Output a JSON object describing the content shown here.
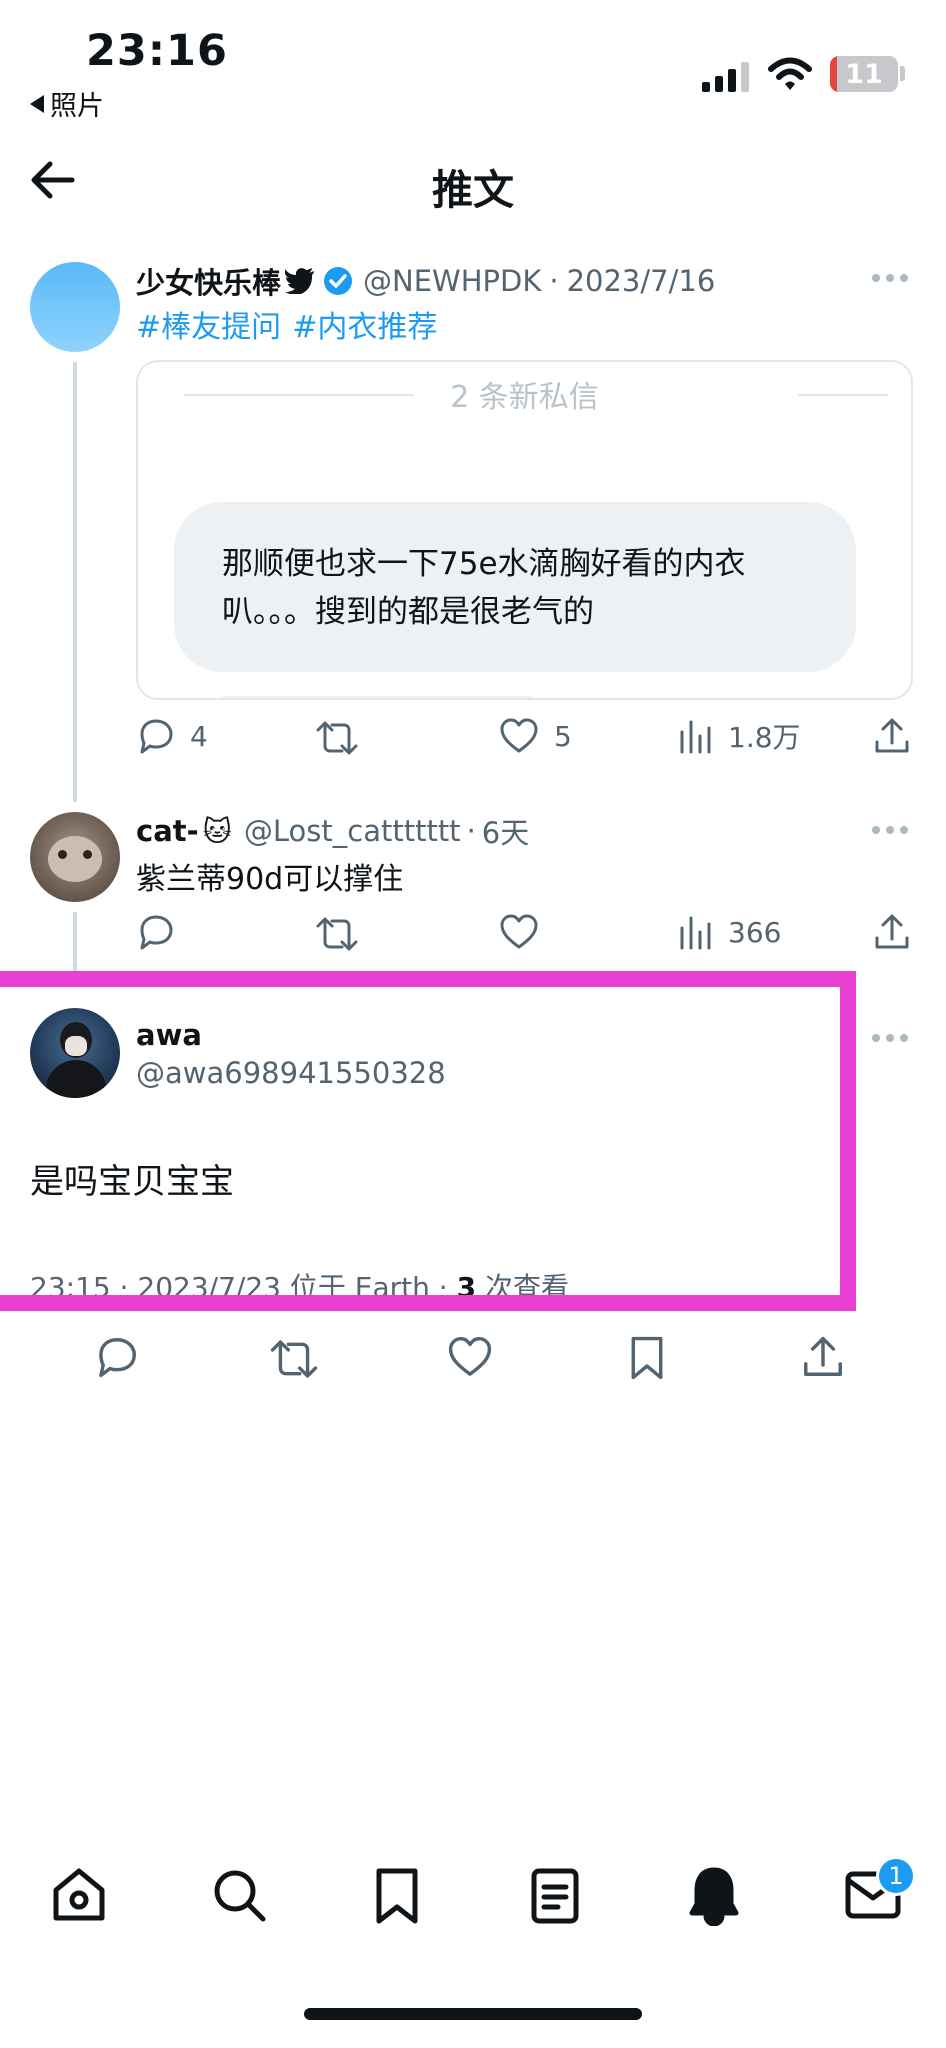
{
  "status_bar": {
    "time": "23:16",
    "back_app": "照片",
    "battery_level": "11"
  },
  "header": {
    "title": "推文"
  },
  "tweet1": {
    "author": "少女快乐棒",
    "handle": "@NEWHPDK",
    "separator": "·",
    "date": "2023/7/16",
    "hashtags": [
      "#棒友提问",
      "#内衣推荐"
    ],
    "quote": {
      "divider_label": "2 条新私信",
      "message": "那顺便也求一下75e水滴胸好看的内衣叭。。。搜到的都是很老气的"
    },
    "stats": {
      "replies": "4",
      "likes": "5",
      "views": "1.8万"
    }
  },
  "tweet2": {
    "author": "cat-",
    "author_emoji": "🐱",
    "handle": "@Lost_cattttttt",
    "separator": "·",
    "date": "6天",
    "text": "紫兰蒂90d可以撑住",
    "stats": {
      "views": "366"
    }
  },
  "focused_tweet": {
    "author": "awa",
    "handle": "@awa698941550328",
    "text": "是吗宝贝宝宝",
    "meta_prefix": "23:15 · 2023/7/23 位于 Earth · ",
    "view_count": "3",
    "view_suffix": " 次查看"
  },
  "tab_bar": {
    "messages_badge": "1"
  },
  "colors": {
    "accent": "#1d9bf0",
    "highlight": "#e93fd2",
    "secondary_text": "#536471"
  }
}
